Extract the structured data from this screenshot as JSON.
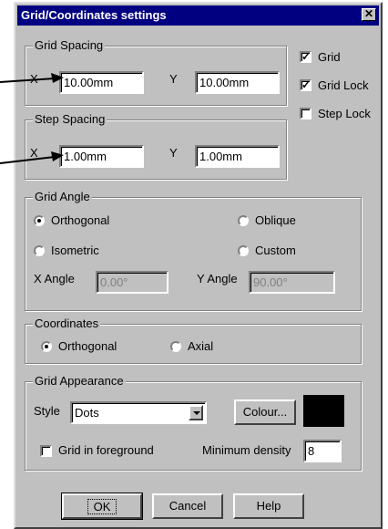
{
  "dialog": {
    "title": "Grid/Coordinates settings",
    "close_glyph": "✕"
  },
  "grid_spacing": {
    "legend": "Grid Spacing",
    "x_label": "X",
    "x_value": "10.00mm",
    "y_label": "Y",
    "y_value": "10.00mm"
  },
  "step_spacing": {
    "legend": "Step Spacing",
    "x_label": "X",
    "x_value": "1.00mm",
    "y_label": "Y",
    "y_value": "1.00mm"
  },
  "checkboxes": {
    "grid": {
      "label": "Grid",
      "checked": true
    },
    "grid_lock": {
      "label": "Grid Lock",
      "checked": true
    },
    "step_lock": {
      "label": "Step Lock",
      "checked": false
    }
  },
  "grid_angle": {
    "legend": "Grid Angle",
    "orthogonal": "Orthogonal",
    "oblique": "Oblique",
    "isometric": "Isometric",
    "custom": "Custom",
    "selected": "Orthogonal",
    "x_angle_label": "X Angle",
    "x_angle_value": "0.00°",
    "y_angle_label": "Y Angle",
    "y_angle_value": "90.00°"
  },
  "coordinates": {
    "legend": "Coordinates",
    "orthogonal": "Orthogonal",
    "axial": "Axial",
    "selected": "Orthogonal"
  },
  "grid_appearance": {
    "legend": "Grid Appearance",
    "style_label": "Style",
    "style_value": "Dots",
    "colour_button": "Colour...",
    "colour_swatch": "#000000",
    "foreground_label": "Grid in foreground",
    "foreground_checked": false,
    "density_label": "Minimum density",
    "density_value": "8"
  },
  "buttons": {
    "ok": "OK",
    "cancel": "Cancel",
    "help": "Help"
  },
  "colors": {
    "face": "#c0c0c0",
    "title_bar": "#000080",
    "title_text": "#ffffff"
  }
}
